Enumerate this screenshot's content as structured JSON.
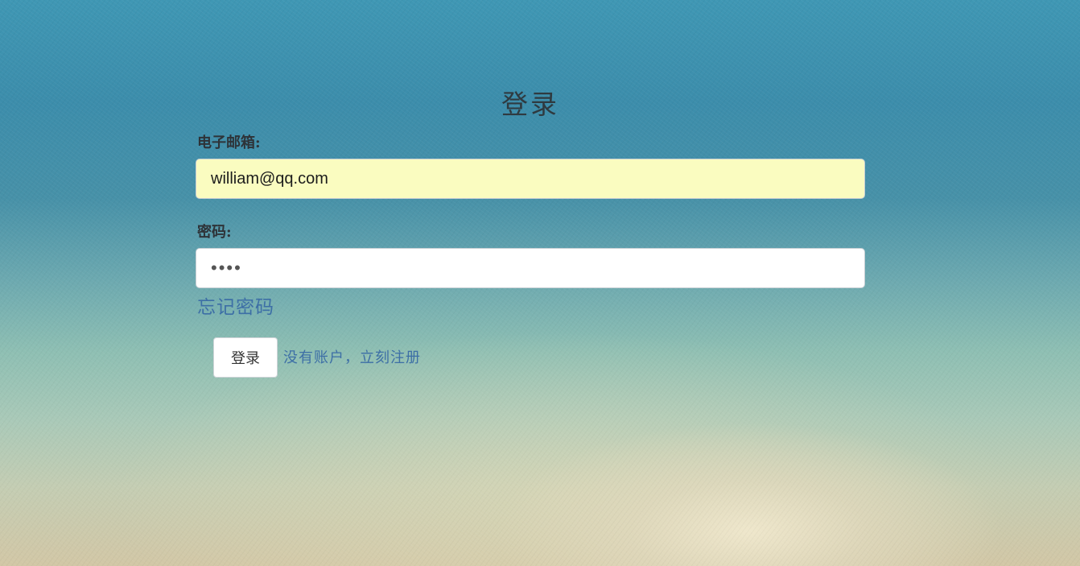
{
  "page": {
    "title": "登录"
  },
  "form": {
    "email_label": "电子邮箱:",
    "email_value": "william@qq.com",
    "password_label": "密码:",
    "password_value": "1234",
    "forgot_password_link": "忘记密码",
    "login_button": "登录",
    "register_link": "没有账户，立刻注册"
  },
  "colors": {
    "email_autofill_bg": "#fafcc0",
    "link": "#3d6fa6",
    "background_top": "#3f97b4",
    "background_bottom": "#d2c7a6"
  }
}
